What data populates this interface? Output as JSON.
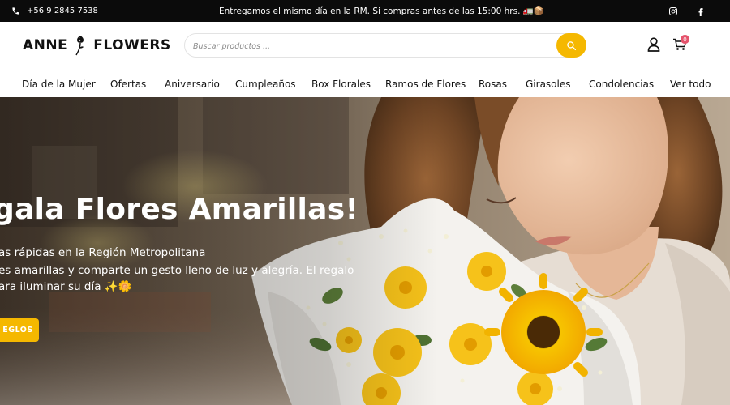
{
  "topbar": {
    "phone": "+56 9 2845 7538",
    "promo": "Entregamos el mismo día en la RM. Si compras antes de las 15:00 hrs. 🚛📦"
  },
  "header": {
    "logo_left": "ANNE",
    "logo_right": "FLOWERS",
    "search_placeholder": "Buscar productos ...",
    "cart_count": "0"
  },
  "nav": {
    "items": [
      "Día de la Mujer",
      "Ofertas",
      "Aniversario",
      "Cumpleaños",
      "Box Florales",
      "Ramos de Flores",
      "Rosas",
      "Girasoles",
      "Condolencias",
      "Ver todo"
    ]
  },
  "hero": {
    "title": "gala Flores Amarillas!",
    "line1": "as rápidas en la Región Metropolitana",
    "line2": "es amarillas y comparte un gesto lleno de luz y alegría. El regalo",
    "line3": "ara iluminar su día ✨🌼",
    "button": "EGLOS"
  },
  "colors": {
    "accent": "#f5b800",
    "topbar_bg": "#0b0b0b",
    "badge": "#e5536c"
  }
}
